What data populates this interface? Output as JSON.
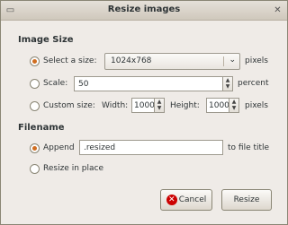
{
  "window": {
    "title": "Resize images",
    "menu_icon": "window-menu-icon",
    "close_icon": "close-icon"
  },
  "image_size": {
    "heading": "Image Size",
    "select_label": "Select a size:",
    "select_value": "1024x768",
    "select_unit": "pixels",
    "scale_label": "Scale:",
    "scale_value": "50",
    "scale_unit": "percent",
    "custom_label": "Custom size:",
    "width_label": "Width:",
    "width_value": "1000",
    "height_label": "Height:",
    "height_value": "1000",
    "custom_unit": "pixels"
  },
  "filename": {
    "heading": "Filename",
    "append_label": "Append",
    "append_value": ".resized",
    "append_suffix": "to file title",
    "inplace_label": "Resize in place"
  },
  "buttons": {
    "cancel": "Cancel",
    "resize": "Resize"
  },
  "colors": {
    "accent": "#d06d20",
    "cancel_icon": "#cc0000"
  }
}
